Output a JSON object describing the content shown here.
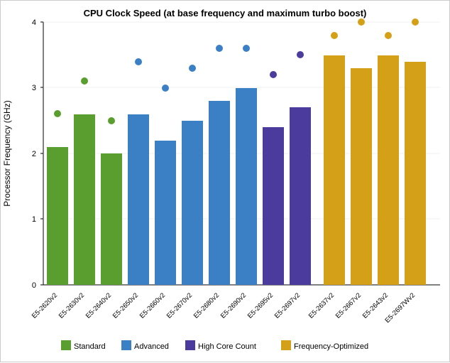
{
  "chart": {
    "title": "CPU Clock Speed (at base frequency and maximum turbo boost)",
    "y_label": "Processor Frequency (GHz)",
    "y_ticks": [
      0,
      1,
      2,
      3,
      4
    ],
    "x_labels": [
      "E5-2620v2",
      "E5-2630v2",
      "E5-2640v2",
      "E5-2650v2",
      "E5-2660v2",
      "E5-2670v2",
      "E5-2680v2",
      "E5-2690v2",
      "E5-2695v2",
      "E5-2697v2",
      "E5-2637v2",
      "E5-2667v2",
      "E5-2643v2",
      "E5-2697Wv2"
    ],
    "legend": [
      {
        "label": "Standard",
        "color": "#5a9e2f"
      },
      {
        "label": "Advanced",
        "color": "#3b7fc4"
      },
      {
        "label": "High Core Count",
        "color": "#4a3b9c"
      },
      {
        "label": "Frequency-Optimized",
        "color": "#d4a017"
      }
    ],
    "bars": [
      {
        "label": "E5-2620v2",
        "base": 2.1,
        "turbo": 2.6,
        "color": "#5a9e2f",
        "type": "standard"
      },
      {
        "label": "E5-2630v2",
        "base": 2.6,
        "turbo": 3.1,
        "color": "#5a9e2f",
        "type": "standard"
      },
      {
        "label": "E5-2640v2",
        "base": 2.0,
        "turbo": 2.5,
        "color": "#5a9e2f",
        "type": "standard"
      },
      {
        "label": "E5-2650v2",
        "base": 2.6,
        "turbo": 3.4,
        "color": "#3b7fc4",
        "type": "advanced"
      },
      {
        "label": "E5-2660v2",
        "base": 2.2,
        "turbo": 3.0,
        "color": "#3b7fc4",
        "type": "advanced"
      },
      {
        "label": "E5-2670v2",
        "base": 2.5,
        "turbo": 3.3,
        "color": "#3b7fc4",
        "type": "advanced"
      },
      {
        "label": "E5-2680v2",
        "base": 2.8,
        "turbo": 3.6,
        "color": "#3b7fc4",
        "type": "advanced"
      },
      {
        "label": "E5-2690v2",
        "base": 3.0,
        "turbo": 3.6,
        "color": "#3b7fc4",
        "type": "advanced"
      },
      {
        "label": "E5-2695v2",
        "base": 2.4,
        "turbo": 3.2,
        "color": "#4a3b9c",
        "type": "hcc"
      },
      {
        "label": "E5-2697v2",
        "base": 2.7,
        "turbo": 3.5,
        "color": "#4a3b9c",
        "type": "hcc"
      },
      {
        "label": "E5-2637v2",
        "base": 3.5,
        "turbo": 3.8,
        "color": "#d4a017",
        "type": "fo"
      },
      {
        "label": "E5-2667v2",
        "base": 3.3,
        "turbo": 4.0,
        "color": "#d4a017",
        "type": "fo"
      },
      {
        "label": "E5-2643v2",
        "base": 3.5,
        "turbo": 3.8,
        "color": "#d4a017",
        "type": "fo"
      },
      {
        "label": "E5-2697Wv2",
        "base": 3.4,
        "turbo": 4.0,
        "color": "#d4a017",
        "type": "fo"
      }
    ]
  }
}
